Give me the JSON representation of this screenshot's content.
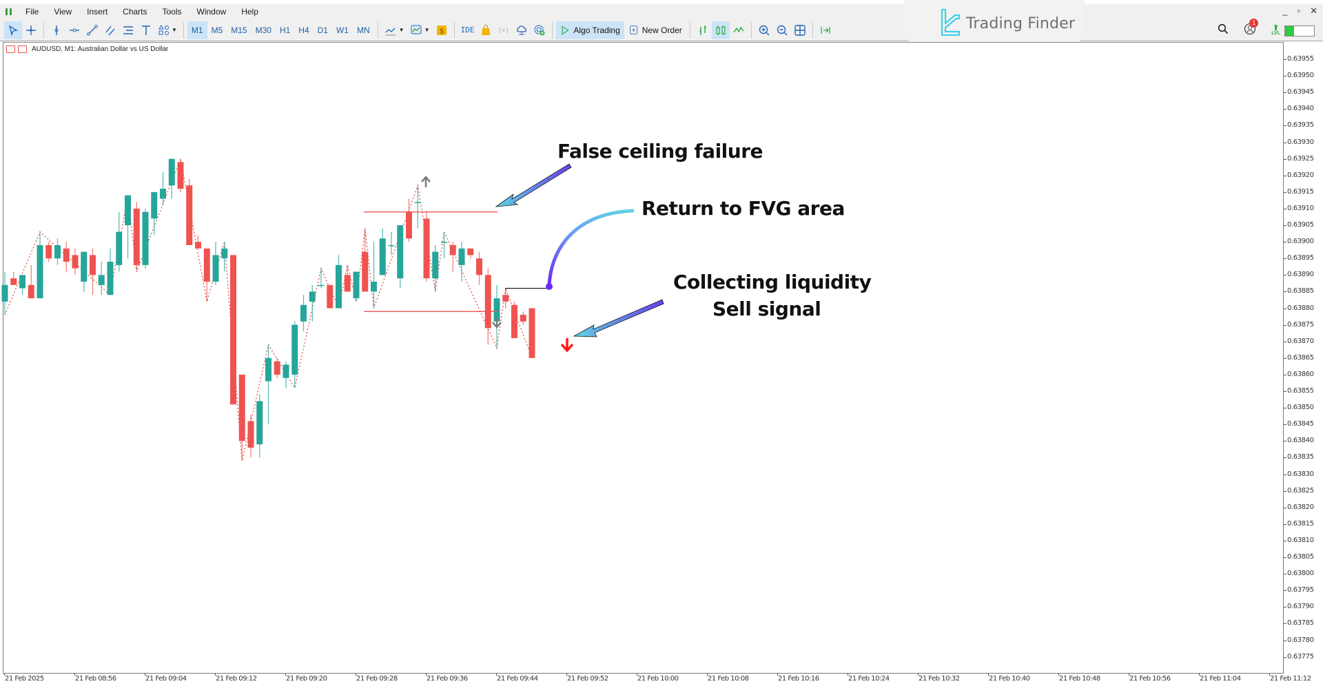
{
  "menubar": {
    "items": [
      "File",
      "View",
      "Insert",
      "Charts",
      "Tools",
      "Window",
      "Help"
    ]
  },
  "toolbar": {
    "timeframes": [
      "M1",
      "M5",
      "M15",
      "M30",
      "H1",
      "H4",
      "D1",
      "W1",
      "MN"
    ],
    "active_timeframe": "M1",
    "ide_label": "IDE",
    "algo_trading_label": "Algo Trading",
    "new_order_label": "New Order",
    "notification_count": "1",
    "level_label": "LVL",
    "level_fill": 0.3
  },
  "branding": {
    "name": "Trading Finder"
  },
  "window_controls": {
    "minimize": "_",
    "restore": "▫",
    "close": "✕"
  },
  "chart": {
    "header": "AUDUSD, M1:  Australian Dollar vs US Dollar",
    "price_labels": [
      "0.63955",
      "0.63950",
      "0.63945",
      "0.63940",
      "0.63935",
      "0.63930",
      "0.63925",
      "0.63920",
      "0.63915",
      "0.63910",
      "0.63905",
      "0.63900",
      "0.63895",
      "0.63890",
      "0.63885",
      "0.63880",
      "0.63875",
      "0.63870",
      "0.63865",
      "0.63860",
      "0.63855",
      "0.63850",
      "0.63845",
      "0.63840",
      "0.63835",
      "0.63830",
      "0.63825",
      "0.63820",
      "0.63815",
      "0.63810",
      "0.63805",
      "0.63800",
      "0.63795",
      "0.63790",
      "0.63785",
      "0.63780",
      "0.63775"
    ],
    "time_labels": [
      "21 Feb 2025",
      "21 Feb 08:56",
      "21 Feb 09:04",
      "21 Feb 09:12",
      "21 Feb 09:20",
      "21 Feb 09:28",
      "21 Feb 09:36",
      "21 Feb 09:44",
      "21 Feb 09:52",
      "21 Feb 10:00",
      "21 Feb 10:08",
      "21 Feb 10:16",
      "21 Feb 10:24",
      "21 Feb 10:32",
      "21 Feb 10:40",
      "21 Feb 10:48",
      "21 Feb 10:56",
      "21 Feb 11:04",
      "21 Feb 11:12"
    ],
    "colors": {
      "bull": "#26a69a",
      "bear": "#ef5350",
      "zigzag": "#d9534f",
      "range_line": "#ef5350",
      "fvg_line": "#111111",
      "signal_arrow": "#ff1a1a",
      "marker_arrow": "#7a7a7a"
    },
    "annotations": [
      {
        "id": "false-ceiling",
        "text": "False ceiling failure"
      },
      {
        "id": "return-fvg",
        "text": "Return to FVG area"
      },
      {
        "id": "collect-liquidity",
        "text": "Collecting liquidity"
      },
      {
        "id": "sell-signal",
        "text": "Sell signal"
      }
    ]
  },
  "chart_data": {
    "type": "candlestick",
    "title": "AUDUSD, M1: Australian Dollar vs US Dollar",
    "xlabel": "",
    "ylabel": "",
    "ylim": [
      0.6377,
      0.6396
    ],
    "x_start": "21 Feb 08:48",
    "interval": "1 minute",
    "range_box": {
      "high": 0.63909,
      "low": 0.63879
    },
    "fvg_level": 0.63886,
    "signal": {
      "type": "sell",
      "index": 51
    },
    "candles": [
      [
        0.63882,
        0.63891,
        0.63878,
        0.63887
      ],
      [
        0.63889,
        0.63891,
        0.63887,
        0.63887
      ],
      [
        0.63886,
        0.6389,
        0.63884,
        0.6389
      ],
      [
        0.63887,
        0.63893,
        0.63883,
        0.63883
      ],
      [
        0.63883,
        0.63903,
        0.63883,
        0.63899
      ],
      [
        0.63899,
        0.639,
        0.63894,
        0.63895
      ],
      [
        0.63895,
        0.63901,
        0.63893,
        0.63899
      ],
      [
        0.63898,
        0.639,
        0.63891,
        0.63894
      ],
      [
        0.63896,
        0.63898,
        0.6389,
        0.63892
      ],
      [
        0.63888,
        0.63895,
        0.63885,
        0.63897
      ],
      [
        0.63896,
        0.63898,
        0.63884,
        0.6389
      ],
      [
        0.63887,
        0.63894,
        0.63884,
        0.6389
      ],
      [
        0.63884,
        0.63898,
        0.63884,
        0.63894
      ],
      [
        0.63893,
        0.63909,
        0.63891,
        0.63903
      ],
      [
        0.63905,
        0.63914,
        0.63895,
        0.63914
      ],
      [
        0.6391,
        0.63912,
        0.63891,
        0.63893
      ],
      [
        0.63893,
        0.6391,
        0.63892,
        0.63909
      ],
      [
        0.63907,
        0.63912,
        0.63902,
        0.63915
      ],
      [
        0.63913,
        0.63921,
        0.63911,
        0.63916
      ],
      [
        0.63917,
        0.63925,
        0.63913,
        0.63925
      ],
      [
        0.63924,
        0.63925,
        0.63915,
        0.63916
      ],
      [
        0.63917,
        0.63919,
        0.63899,
        0.63899
      ],
      [
        0.639,
        0.63902,
        0.63898,
        0.63898
      ],
      [
        0.63898,
        0.63898,
        0.63882,
        0.63888
      ],
      [
        0.63888,
        0.639,
        0.63887,
        0.63896
      ],
      [
        0.63895,
        0.639,
        0.63891,
        0.63898
      ],
      [
        0.63896,
        0.63896,
        0.63851,
        0.63851
      ],
      [
        0.6386,
        0.6386,
        0.63834,
        0.6384
      ],
      [
        0.63846,
        0.63848,
        0.63835,
        0.63838
      ],
      [
        0.63839,
        0.63854,
        0.63835,
        0.63852
      ],
      [
        0.63858,
        0.63869,
        0.63845,
        0.63865
      ],
      [
        0.63864,
        0.63865,
        0.63859,
        0.6386
      ],
      [
        0.63859,
        0.63864,
        0.63856,
        0.63863
      ],
      [
        0.6386,
        0.63876,
        0.63856,
        0.63875
      ],
      [
        0.63876,
        0.63884,
        0.63873,
        0.63881
      ],
      [
        0.63882,
        0.63887,
        0.63876,
        0.63885
      ],
      [
        0.63887,
        0.63892,
        0.63886,
        0.63887
      ],
      [
        0.63887,
        0.63887,
        0.6388,
        0.6388
      ],
      [
        0.6388,
        0.63896,
        0.6388,
        0.63893
      ],
      [
        0.6389,
        0.63893,
        0.63885,
        0.63885
      ],
      [
        0.63883,
        0.63888,
        0.63882,
        0.63891
      ],
      [
        0.63897,
        0.63904,
        0.63885,
        0.63885
      ],
      [
        0.63885,
        0.639,
        0.6388,
        0.63888
      ],
      [
        0.6389,
        0.63904,
        0.6389,
        0.63901
      ],
      [
        0.63899,
        0.63903,
        0.63896,
        0.63899
      ],
      [
        0.63889,
        0.63904,
        0.63886,
        0.63905
      ],
      [
        0.63909,
        0.63913,
        0.639,
        0.63901
      ],
      [
        0.63912,
        0.63917,
        0.63904,
        0.63912
      ],
      [
        0.63907,
        0.63909,
        0.63888,
        0.63889
      ],
      [
        0.63889,
        0.63899,
        0.63885,
        0.63897
      ],
      [
        0.639,
        0.63903,
        0.63895,
        0.639
      ],
      [
        0.63899,
        0.639,
        0.63891,
        0.63896
      ],
      [
        0.63893,
        0.639,
        0.63888,
        0.63898
      ],
      [
        0.63898,
        0.63898,
        0.63895,
        0.63896
      ],
      [
        0.63895,
        0.63897,
        0.63887,
        0.6389
      ],
      [
        0.6389,
        0.63892,
        0.63869,
        0.63874
      ],
      [
        0.63876,
        0.63887,
        0.63868,
        0.63883
      ],
      [
        0.63884,
        0.63886,
        0.6388,
        0.63882
      ],
      [
        0.63881,
        0.63882,
        0.63872,
        0.63871
      ],
      [
        0.63878,
        0.63879,
        0.63875,
        0.63876
      ],
      [
        0.6388,
        0.6388,
        0.63865,
        0.63865
      ]
    ]
  }
}
